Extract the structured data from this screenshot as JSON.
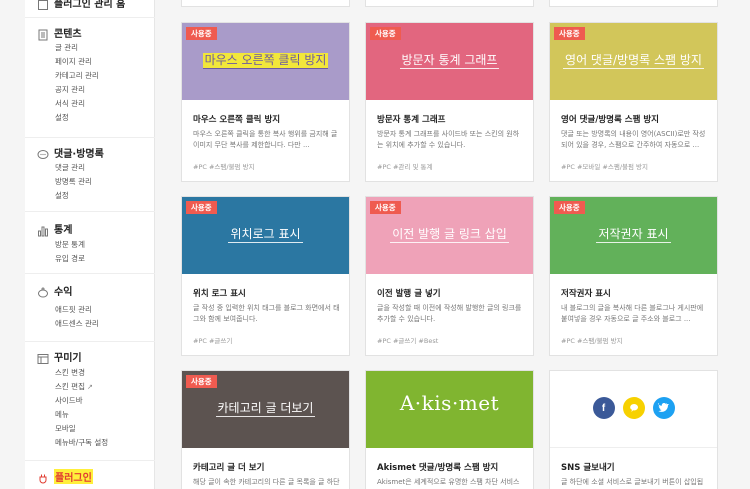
{
  "sidebar": {
    "top_item": "플러그인 관리 홈",
    "content": {
      "title": "콘텐츠",
      "items": [
        "글 관리",
        "페이지 관리",
        "카테고리 관리",
        "공지 관리",
        "서식 관리",
        "설정"
      ]
    },
    "comments": {
      "title": "댓글·방명록",
      "items": [
        "댓글 관리",
        "방명록 관리",
        "설정"
      ]
    },
    "stats": {
      "title": "통계",
      "items": [
        "방문 통계",
        "유입 경로"
      ]
    },
    "revenue": {
      "title": "수익",
      "items": [
        "애드핏 관리",
        "애드센스 관리"
      ]
    },
    "decor": {
      "title": "꾸미기",
      "items": [
        "스킨 변경",
        "스킨 편집",
        "사이드바",
        "메뉴",
        "모바일",
        "메뉴바/구독 설정"
      ]
    },
    "plugin": {
      "title": "플러그인"
    }
  },
  "cards": [
    {
      "badge": "사용중",
      "thumb_title": "마우스 오른쪽 클릭 방지",
      "name": "마우스 오른쪽 클릭 방지",
      "desc": "마우스 오른쪽 클릭을 통한 복사 행위를 금지해 글 이미지 무단 복사를 제한합니다. 다만 ...",
      "tags": "#PC   #스팸/불펌 방지",
      "color": "#a99bc9"
    },
    {
      "badge": "사용중",
      "thumb_title": "방문자 통계 그래프",
      "name": "방문자 통계 그래프",
      "desc": "방문자 통계 그래프를 사이드바 또는 스킨의 원하는 위치에 추가할 수 있습니다.",
      "tags": "#PC   #관리 및 통계",
      "color": "#e2667f"
    },
    {
      "badge": "사용중",
      "thumb_title": "영어 댓글/방명록 스팸 방지",
      "name": "영어 댓글/방명록 스팸 방지",
      "desc": "댓글 또는 방명록의 내용이 영어(ASCII)로만 작성되어 있을 경우, 스팸으로 간주하여 자동으로 ...",
      "tags": "#PC   #모바일   #스팸/불펌 방지",
      "color": "#d2c65a"
    },
    {
      "badge": "사용중",
      "thumb_title": "위치로그 표시",
      "name": "위치 로그 표시",
      "desc": "글 작성 중 입력한 위치 태그를 블로그 화면에서 태그와 함께 보여줍니다.",
      "tags": "#PC   #글쓰기",
      "color": "#2b77a2"
    },
    {
      "badge": "사용중",
      "thumb_title": "이전 발행 글 링크 삽입",
      "name": "이전 발행 글 넣기",
      "desc": "글을 작성할 때 이전에 작성해 발행한 글의 링크를 추가할 수 있습니다.",
      "tags": "#PC   #글쓰기   #Best",
      "color": "#efa2b8"
    },
    {
      "badge": "사용중",
      "thumb_title": "저작권자 표시",
      "name": "저작권자 표시",
      "desc": "내 블로그의 글을 복사해 다른 블로그나 게시판에 붙여넣을 경우 자동으로 글 주소와 블로그 ...",
      "tags": "#PC   #스팸/불펌 방지",
      "color": "#62b15a"
    },
    {
      "badge": "사용중",
      "thumb_title": "카테고리 글 더보기",
      "name": "카테고리 글 더 보기",
      "desc": "해당 글이 속한 카테고리의 다른 글 목록을 글 하단에 보여줍니다.",
      "tags": "",
      "color": "#5c5350"
    },
    {
      "badge": "",
      "thumb_title": "A·kis·met",
      "name": "Akismet 댓글/방명록 스팸 방지",
      "desc": "Akismet은 세계적으로 유명한 스팸 차단 서비스로 ...",
      "tags": "",
      "color": "#80b530"
    },
    {
      "badge": "",
      "thumb_title": "",
      "name": "SNS 글보내기",
      "desc": "글 하단에 소셜 서비스로 글보내기 버튼이 삽입됩니다.",
      "tags": "",
      "color": "#ffffff"
    }
  ],
  "sns_icons": [
    "f",
    "t",
    "✓"
  ],
  "colors": {
    "badge": "#ef5b50",
    "highlight": "#ffef3b",
    "facebook": "#3b5998",
    "kakao": "#f7d100",
    "twitter": "#1da1f2"
  }
}
